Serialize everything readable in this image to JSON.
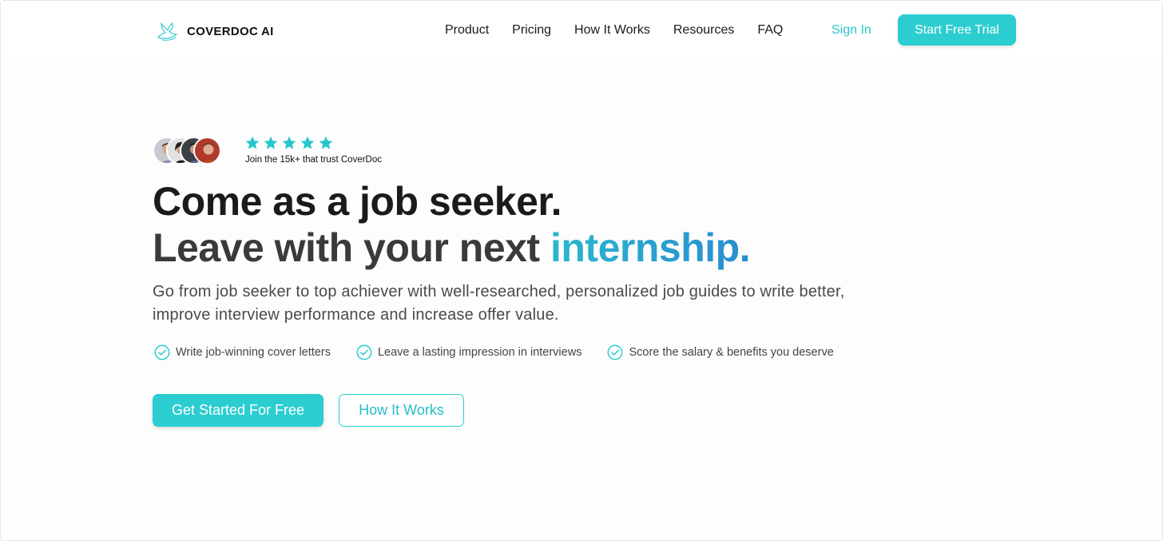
{
  "brand": {
    "name": "COVERDOC AI",
    "logo_icon": "rabbit-logo-icon",
    "accent_color": "#2ccdd0"
  },
  "nav": {
    "items": [
      {
        "label": "Product"
      },
      {
        "label": "Pricing"
      },
      {
        "label": "How It Works"
      },
      {
        "label": "Resources"
      },
      {
        "label": "FAQ"
      }
    ],
    "sign_in": "Sign In",
    "trial_button": "Start Free Trial"
  },
  "social_proof": {
    "rating_stars": 5,
    "trust_text": "Join the 15k+ that trust CoverDoc"
  },
  "hero": {
    "headline_line1": "Come as a job seeker.",
    "headline_line2_prefix": "Leave with your next",
    "headline_highlight": "internship.",
    "subtext": "Go from job seeker to top achiever with well-researched, personalized job guides to write better, improve interview performance and increase offer value.",
    "features": [
      {
        "icon": "check-circle-icon",
        "label": "Write job-winning cover letters"
      },
      {
        "icon": "check-circle-icon",
        "label": "Leave a lasting impression in interviews"
      },
      {
        "icon": "check-circle-icon",
        "label": "Score the salary & benefits you deserve"
      }
    ],
    "primary_cta": "Get Started For Free",
    "secondary_cta": "How It Works"
  }
}
